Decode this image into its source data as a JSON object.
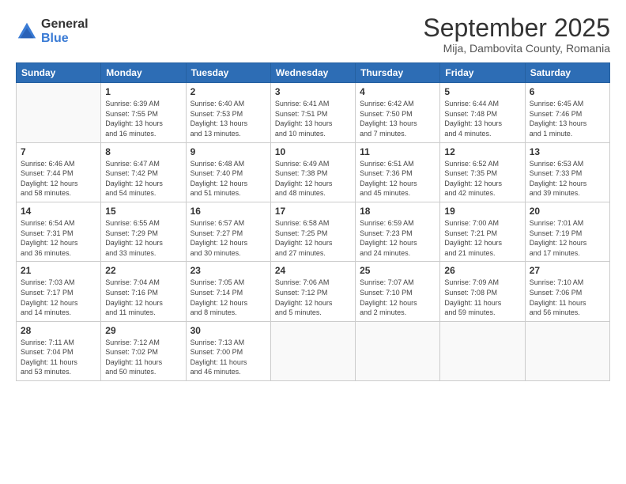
{
  "logo": {
    "general": "General",
    "blue": "Blue"
  },
  "title": "September 2025",
  "location": "Mija, Dambovita County, Romania",
  "weekdays": [
    "Sunday",
    "Monday",
    "Tuesday",
    "Wednesday",
    "Thursday",
    "Friday",
    "Saturday"
  ],
  "weeks": [
    [
      {
        "day": "",
        "info": ""
      },
      {
        "day": "1",
        "info": "Sunrise: 6:39 AM\nSunset: 7:55 PM\nDaylight: 13 hours\nand 16 minutes."
      },
      {
        "day": "2",
        "info": "Sunrise: 6:40 AM\nSunset: 7:53 PM\nDaylight: 13 hours\nand 13 minutes."
      },
      {
        "day": "3",
        "info": "Sunrise: 6:41 AM\nSunset: 7:51 PM\nDaylight: 13 hours\nand 10 minutes."
      },
      {
        "day": "4",
        "info": "Sunrise: 6:42 AM\nSunset: 7:50 PM\nDaylight: 13 hours\nand 7 minutes."
      },
      {
        "day": "5",
        "info": "Sunrise: 6:44 AM\nSunset: 7:48 PM\nDaylight: 13 hours\nand 4 minutes."
      },
      {
        "day": "6",
        "info": "Sunrise: 6:45 AM\nSunset: 7:46 PM\nDaylight: 13 hours\nand 1 minute."
      }
    ],
    [
      {
        "day": "7",
        "info": "Sunrise: 6:46 AM\nSunset: 7:44 PM\nDaylight: 12 hours\nand 58 minutes."
      },
      {
        "day": "8",
        "info": "Sunrise: 6:47 AM\nSunset: 7:42 PM\nDaylight: 12 hours\nand 54 minutes."
      },
      {
        "day": "9",
        "info": "Sunrise: 6:48 AM\nSunset: 7:40 PM\nDaylight: 12 hours\nand 51 minutes."
      },
      {
        "day": "10",
        "info": "Sunrise: 6:49 AM\nSunset: 7:38 PM\nDaylight: 12 hours\nand 48 minutes."
      },
      {
        "day": "11",
        "info": "Sunrise: 6:51 AM\nSunset: 7:36 PM\nDaylight: 12 hours\nand 45 minutes."
      },
      {
        "day": "12",
        "info": "Sunrise: 6:52 AM\nSunset: 7:35 PM\nDaylight: 12 hours\nand 42 minutes."
      },
      {
        "day": "13",
        "info": "Sunrise: 6:53 AM\nSunset: 7:33 PM\nDaylight: 12 hours\nand 39 minutes."
      }
    ],
    [
      {
        "day": "14",
        "info": "Sunrise: 6:54 AM\nSunset: 7:31 PM\nDaylight: 12 hours\nand 36 minutes."
      },
      {
        "day": "15",
        "info": "Sunrise: 6:55 AM\nSunset: 7:29 PM\nDaylight: 12 hours\nand 33 minutes."
      },
      {
        "day": "16",
        "info": "Sunrise: 6:57 AM\nSunset: 7:27 PM\nDaylight: 12 hours\nand 30 minutes."
      },
      {
        "day": "17",
        "info": "Sunrise: 6:58 AM\nSunset: 7:25 PM\nDaylight: 12 hours\nand 27 minutes."
      },
      {
        "day": "18",
        "info": "Sunrise: 6:59 AM\nSunset: 7:23 PM\nDaylight: 12 hours\nand 24 minutes."
      },
      {
        "day": "19",
        "info": "Sunrise: 7:00 AM\nSunset: 7:21 PM\nDaylight: 12 hours\nand 21 minutes."
      },
      {
        "day": "20",
        "info": "Sunrise: 7:01 AM\nSunset: 7:19 PM\nDaylight: 12 hours\nand 17 minutes."
      }
    ],
    [
      {
        "day": "21",
        "info": "Sunrise: 7:03 AM\nSunset: 7:17 PM\nDaylight: 12 hours\nand 14 minutes."
      },
      {
        "day": "22",
        "info": "Sunrise: 7:04 AM\nSunset: 7:16 PM\nDaylight: 12 hours\nand 11 minutes."
      },
      {
        "day": "23",
        "info": "Sunrise: 7:05 AM\nSunset: 7:14 PM\nDaylight: 12 hours\nand 8 minutes."
      },
      {
        "day": "24",
        "info": "Sunrise: 7:06 AM\nSunset: 7:12 PM\nDaylight: 12 hours\nand 5 minutes."
      },
      {
        "day": "25",
        "info": "Sunrise: 7:07 AM\nSunset: 7:10 PM\nDaylight: 12 hours\nand 2 minutes."
      },
      {
        "day": "26",
        "info": "Sunrise: 7:09 AM\nSunset: 7:08 PM\nDaylight: 11 hours\nand 59 minutes."
      },
      {
        "day": "27",
        "info": "Sunrise: 7:10 AM\nSunset: 7:06 PM\nDaylight: 11 hours\nand 56 minutes."
      }
    ],
    [
      {
        "day": "28",
        "info": "Sunrise: 7:11 AM\nSunset: 7:04 PM\nDaylight: 11 hours\nand 53 minutes."
      },
      {
        "day": "29",
        "info": "Sunrise: 7:12 AM\nSunset: 7:02 PM\nDaylight: 11 hours\nand 50 minutes."
      },
      {
        "day": "30",
        "info": "Sunrise: 7:13 AM\nSunset: 7:00 PM\nDaylight: 11 hours\nand 46 minutes."
      },
      {
        "day": "",
        "info": ""
      },
      {
        "day": "",
        "info": ""
      },
      {
        "day": "",
        "info": ""
      },
      {
        "day": "",
        "info": ""
      }
    ]
  ]
}
